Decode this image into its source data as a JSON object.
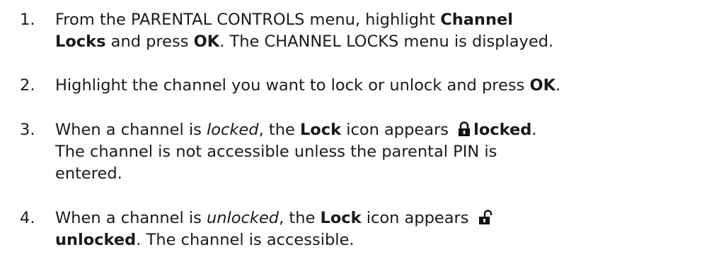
{
  "steps": [
    {
      "number": "1.",
      "l1_pre": "From the PARENTAL CONTROLS menu, highlight ",
      "l1_bold": "Channel",
      "l2_bold1": "Locks",
      "l2_mid": " and press ",
      "l2_bold2": "OK",
      "l2_post": ". The CHANNEL LOCKS menu is displayed."
    },
    {
      "number": "2.",
      "l1_pre": "Highlight the channel you want to lock or unlock and press ",
      "l1_bold": "OK",
      "l1_post": "."
    },
    {
      "number": "3.",
      "l1_pre": "When a channel is ",
      "l1_italic": "locked",
      "l1_mid": ", the ",
      "l1_bold": "Lock",
      "l1_mid2": " icon appears ",
      "icon": "locked-padlock-icon",
      "l1_bold2": "locked",
      "l1_post": ".",
      "l2": "The channel is not accessible unless the parental PIN is",
      "l3": "entered."
    },
    {
      "number": "4.",
      "l1_pre": "When a channel is ",
      "l1_italic": "unlocked",
      "l1_mid": ", the ",
      "l1_bold": "Lock",
      "l1_mid2": " icon appears ",
      "icon": "unlocked-padlock-icon",
      "l2_bold": "unlocked",
      "l2_post": ". The channel is accessible."
    }
  ]
}
